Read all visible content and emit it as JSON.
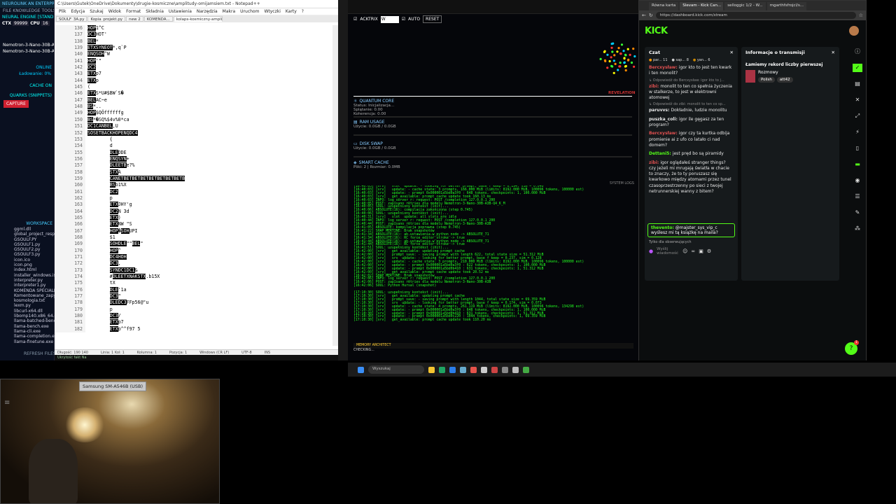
{
  "left_app": {
    "header": "NEUROLINK AN ENTERPRISE VIBRATOR",
    "menu": "FILE  KNOWLEDGE  TOOLS  LIMIT",
    "engine_label": "NEURAL ENGINE [STANDBY]",
    "ctx_label": "CTX",
    "ctx_value": "99999",
    "cpu_label": "CPU",
    "cpu_value": "16",
    "model_lines": [
      "Nemotron-3-Nano-30B-A3B",
      "Nemotron-3-Nano-30B-A3B"
    ],
    "online": "ONLINE",
    "loading": "Ładowanie: 0%",
    "cache_on": "CACHE ON",
    "quarks": "QUARKS (SNIPPETS)",
    "capture": "CAPTURE",
    "workspace": "WORKSPACE",
    "files": [
      "ggml.dll",
      "global_project_resp...",
      "GSOULF.PY",
      "GSOULF1.py",
      "GSOULF2.py",
      "GSOULF3.py",
      "icon.ico",
      "icon.png",
      "index.html",
      "installer_windows.iss",
      "interpreter.py",
      "interpreter1.py",
      "KOMENDA SPECIALNA",
      "Komentowane_zapyt...",
      "kosmologia.txt",
      "lexm.py",
      "libcurl-x64.dll",
      "libomp140.x86_64.dll",
      "llama-batched-bench",
      "llama-bench.exe",
      "llama-cli.exe",
      "llama-completion.exe",
      "llama-finetune.exe"
    ],
    "refresh": "REFRESH FILES"
  },
  "notepad": {
    "title": "C:\\Users\\Gutek\\OneDrive\\Dokumenty\\drugie-kosmiczne\\amplitudy-omijamsiem.txt - Notepad++",
    "menu": [
      "Plik",
      "Edycja",
      "Szukaj",
      "Widok",
      "Format",
      "Składnia",
      "Ustawienia",
      "Narzędzia",
      "Makra",
      "Uruchom",
      "Wtyczki",
      "Karty",
      "?"
    ],
    "tabs": [
      "SOULF_3A.py",
      "Kopia_projekt.py",
      "new 2",
      "KOMENDA...",
      "kolaps-kosmiczny-amplitudy-omijamsiem.txt"
    ],
    "lines": [
      {
        "n": "136",
        "t": "HOP1^C"
      },
      {
        "n": "137",
        "t": "DC3HOT'"
      },
      {
        "n": "138",
        "t": "BEL*"
      },
      {
        "n": "139",
        "t": "ETXSYNEOT*,q`P"
      },
      {
        "n": "140",
        "t": "ENQSOH^W"
      },
      {
        "n": "141",
        "t": "HOP'\""
      },
      {
        "n": "142",
        "t": "DC2"
      },
      {
        "n": "143",
        "t": "ETXp7"
      },
      {
        "n": "144",
        "t": "ETXp"
      },
      {
        "n": "145",
        "t": "("
      },
      {
        "n": "146",
        "t": "ETXS*U#$BW`S�"
      },
      {
        "n": "147",
        "t": "BELAC~e"
      },
      {
        "n": "148",
        "t": "BS*.."
      },
      {
        "n": "149",
        "t": "HOP$QÖffffffg"
      },
      {
        "n": "150",
        "t": "BS*�SQ%$4v%0*ca"
      },
      {
        "n": "151",
        "t": "DC1CANBEL,U"
      },
      {
        "n": "152",
        "t": "SOSETBACKHOPENQDC4"
      },
      {
        "n": "153",
        "t": "        {"
      },
      {
        "n": "154",
        "t": "        d"
      },
      {
        "n": "155",
        "t": "        DLEDDE"
      },
      {
        "n": "156",
        "t": "        ENQSYN+"
      },
      {
        "n": "157",
        "t": "        DLEETBe?%"
      },
      {
        "n": "158",
        "t": "        STXA"
      },
      {
        "n": "159",
        "t": "        CANETBETBETBETBETBETBETBETB"
      },
      {
        "n": "160",
        "t": "        BSb1%X"
      },
      {
        "n": "161",
        "t": "        DC2"
      },
      {
        "n": "162",
        "t": "        p"
      },
      {
        "n": "163",
        "t": "        ETXJHY'g"
      },
      {
        "n": "164",
        "t": "        DC2N 3d"
      },
      {
        "n": "165",
        "t": "        ETX)"
      },
      {
        "n": "166",
        "t": "        ETXNW \"S"
      },
      {
        "n": "167",
        "t": "        HOP�SOHUPI"
      },
      {
        "n": "168",
        "t": "        $1"
      },
      {
        "n": "169",
        "t": "        SOHDLE\"\"BEL\""
      },
      {
        "n": "170",
        "t": "        HOP^"
      },
      {
        "n": "171",
        "t": "        DC4HOH"
      },
      {
        "n": "172",
        "t": "        DC3,"
      },
      {
        "n": "173",
        "t": "        SYNDC1DC1&"
      },
      {
        "n": "174",
        "t": "        #DLEETXNAKSTX.b15X"
      },
      {
        "n": "175",
        "t": "        tX"
      },
      {
        "n": "176",
        "t": "        DLE'1a"
      },
      {
        "n": "177",
        "t": "        DC3\""
      },
      {
        "n": "178",
        "t": "        DLEDC3FFp56@\"u"
      },
      {
        "n": "179",
        "t": "        p"
      },
      {
        "n": "180",
        "t": "        DC3/"
      },
      {
        "n": "181",
        "t": "        ETXp7"
      },
      {
        "n": "182",
        "t": "        ETXp^^f97 5"
      }
    ],
    "status": [
      "Długość: 190 140",
      "Linia: 1 Kol: 1",
      "Kolumna: 1",
      "Pozycja: 1",
      "Windows (CR LF)",
      "UTF-8",
      "INS"
    ],
    "bottom": "Ukrytość fakt Na"
  },
  "mid": {
    "ack": "ACKTRIX",
    "input_value": "W",
    "auto": "AUTO",
    "reset": "RESET",
    "quantum_core": "QUANTUM CORE",
    "status_init": "Status: Inicjalizacja...",
    "splatanie": "Splątanie: 0.00",
    "koherencja": "Koherencja: 0.00",
    "ram_usage": "RAM USAGE",
    "ram_value": "Użycie: 0.0GB / 0.0GB",
    "disk_swap": "DISK SWAP",
    "disk_value": "Użycie: 0.0GB / 0.0GB",
    "smart_cache": "SMART CACHE",
    "cache_value": "Pliki: 2 | Rozmiar: 0.0MB",
    "revelation": "REVELATION",
    "system_logs": "SYSTEM LOGS",
    "memory": "MEMORY ARCHITECT",
    "checking": "CHECKING...",
    "log_lines": [
      "[16:40:03] [srv]   slot  update: - looking for better prompt, base f_keep = 0.194, sim = 0.040",
      "[16:40:03] [srv]   update: - cache state: 3 prompts, 166.000 MiB (limits: 8192.000 MiB, 100096 tokens, 100000 est)",
      "[16:40:03] [srv]   update: - prompt 0x000001a5bd0a3f0 : 648 tokens, checkpoints: 1, 100.000 MiB",
      "[16:40:03] [srv]   get_available: prompt cache update took 160.13 ms",
      "[16:40:03] INFO: log_server_r: request: POST /completion 127.0.0.1 200",
      "[16:40:05] POST: zapisano retries dla modelu Nemotron-3-Nano-30B-A3B-Q4_K_M",
      "[16:40:05] SOUL: uzupełniony kontekst (init)...",
      "[16:40:06] ABSOLUTE(16): compilacja zakończona (step 0.745)",
      "[16:40:06] SOUL: uzupełniony kontekst (init)...",
      "[16:40:31] [srv]   slot  update: all slots are idle",
      "[16:40:44] INFO: log_server_r: request: POST /completion 127.0.0.1 200",
      "[16:40:44] POST: zapisano retries dla modelu Nemotron-3-Nano-30B-A3B",
      "[16:41:05] ABSOLUTE: kompilacja poprawna (step 0.745)",
      "[16:41:22] SHAP MERTINE: Brak snapshotów",
      "[16:41:34] ABSOLUTE(16): ab.ustawienia.w_python_node -> ABSOLUTE_71",
      "[16:41:34] ABSOLUTE(16): RC force_editor_stroke -> true",
      "[16:41:44] ABSOLUTE(16): ab.ustawienia.w_python_node -> ABSOLUTE_71",
      "[16:41:44] ABSOLUTE(16): RC force_editor_stroke -> true",
      "[16:41:51] SOUL: uzupełniony kontekst (init)...",
      "[16:42:00] [srv]   get_available: updating prompt cache",
      "[16:42:00] [srv]   prompt_save: - saving prompt with length 622, total state size = 51.312 MiB",
      "[16:42:00] [srv]   srv  update: - looking for better prompt, base f_keep = 0.237, sim = 0.128",
      "[16:42:00] [srv]   update: - cache state: 3 prompts, 210.000 MiB (limits: 8192.000 MiB, 100096 tokens, 100000 est)",
      "[16:42:00] [srv]   update: - prompt 0x000001a5bd0a3f0 : 622 tokens, checkpoints: 1, 100.000 MiB",
      "[16:42:00] [srv]   update: - prompt 0x000001a5bd0b410 : 631 tokens, checkpoints: 1, 51.312 MiB",
      "[16:42:00] [srv]   get_available: prompt cache update took 20.52 ms",
      "[16:42:02] SHAP MERTINE: Brak snapshotów",
      "[16:42:06] INFO: log_server_r: request: POST /completion 127.0.0.1 200",
      "[16:42:06] POST: zapisano retries dla modelu Nemotron-3-Nano-30B-A3B",
      "[16:42:06] SOUL: Python Hursal (snapshot)",
      "",
      "[17:10:30] SOUL: uzupełniony kontekst (init)...",
      "[17:10:30] [srv]   get_available: updating prompt cache",
      "[17:10:30] [srv]   prompt_save: - saving prompt with length 1044, total state size = 69.359 MiB",
      "[17:10:30] [srv]   srv  update: - looking for better prompt, base f_keep = 0.174, sim = 0.073",
      "[17:10:30] [srv]   update: - cache state: 4 prompts, 261.119 MiB (limits: 8192.000 MiB, 100096 tokens, 134298 est)",
      "[17:10:30] [srv]   update: - prompt 0x000001a5bd0a3f0 : 648 tokens, checkpoints: 1, 100.000 MiB",
      "[17:10:30] [srv]   update: - prompt 0x000001a5bd0b410 : 631 tokens, checkpoints: 1, 51.312 MiB",
      "[17:10:30] [srv]   update: - prompt 0x000001a5bd0c220 : 1044 tokens, checkpoints: 1, 69.359 MiB",
      "[17:10:30] [srv]   get_available: prompt cache update took 110.20 ms"
    ]
  },
  "browser": {
    "tabs": [
      "Równa karta",
      "Slevam - Kick Can...",
      "selloggic 1/2 - W...",
      "mgarthfsfrojcl/s..."
    ],
    "url": "https://dashboard.kick.com/stream",
    "kick": "KICK",
    "chat_title": "Czat",
    "top_chatters": [
      {
        "name": "par...",
        "count": "11"
      },
      {
        "name": "sap...",
        "count": "8"
      },
      {
        "name": "yan...",
        "count": "6"
      }
    ],
    "messages": [
      {
        "u": "Bercxysław:",
        "t": "igor kto to jest ten kwark i ten monolit?",
        "c": "#e05050"
      },
      {
        "r": "Odpowiedź do Bercxysław: igor kto to j..."
      },
      {
        "u": "zibi:",
        "t": "monolit to ten co spełnia życzenia w stalkerze, to jest w elektrowni atomowej",
        "c": "#e05050"
      },
      {
        "r": "Odpowiedź do zibi: monolit to ten co sp..."
      },
      {
        "u": "paruvvs:",
        "t": "Dokładnie, ludzie monolitu",
        "c": "#e8e8e8"
      },
      {
        "u": "puszka_coli:",
        "t": "igor ile gęgasz za ten program?",
        "c": "#e8e8e8"
      },
      {
        "u": "Bercxysław:",
        "t": "igor czy ta kurtka odbija promienie ai z ufo co latało ci nad domem?",
        "c": "#e05050"
      },
      {
        "u": "Dettani5:",
        "t": "jest pręd bo są piramidy",
        "c": "#53fc18"
      },
      {
        "u": "zibi:",
        "t": "igor oglądałeś stranger things? czy jeżeli mi mrugają światła w chacie to znaczy, że to ty poruszasz się kwarkowo między atomami przez tunel czasoprzestrzenny po sieci z twojej netrunnerskiej wanny z bitem?",
        "c": "#e05050"
      }
    ],
    "pinned_user": "thevento:",
    "pinned_text": "@majster_sys_vip_c wyślesz mi tą książkę na maila?",
    "followers_only": "Tylko dla obserwujących",
    "send_placeholder": "Wyślij wiadomość",
    "info_title": "Informacje o transmisji",
    "stream_title": "Łamiemy rekord liczby pierwszej",
    "category": "Rozmowy",
    "tags": [
      "Polish",
      "att42"
    ],
    "notif_count": "1"
  },
  "taskbar": {
    "search": "Wyszukaj"
  },
  "cam": {
    "label": "Samsung SM-A546B (USB)"
  },
  "colors": {
    "accent": "#53fc18",
    "term_green": "#22ff22",
    "alert_red": "#d02030"
  }
}
